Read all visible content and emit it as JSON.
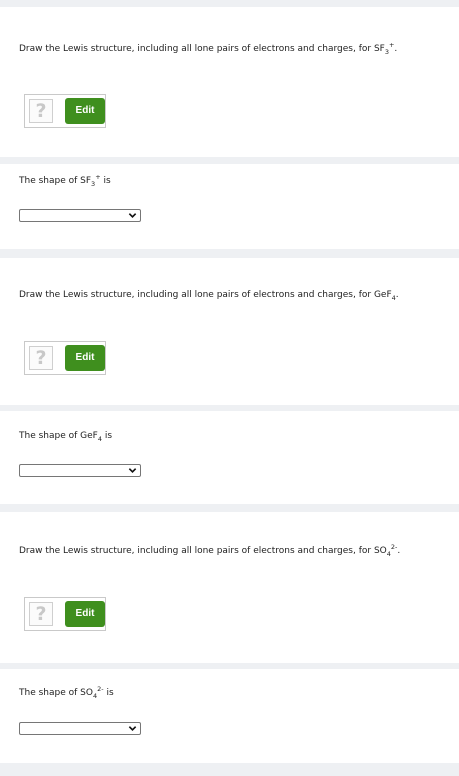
{
  "questions": [
    {
      "draw_prefix": "Draw the Lewis structure, including all lone pairs of electrons and charges, for ",
      "formula_base": "SF",
      "formula_sub": "3",
      "formula_sup": "+",
      "draw_suffix": ".",
      "edit_label": "Edit",
      "help_glyph": "?",
      "shape_prefix": "The shape of ",
      "shape_suffix": " is",
      "shape_selected": ""
    },
    {
      "draw_prefix": "Draw the Lewis structure, including all lone pairs of electrons and charges, for ",
      "formula_base": "GeF",
      "formula_sub": "4",
      "formula_sup": "",
      "draw_suffix": ".",
      "edit_label": "Edit",
      "help_glyph": "?",
      "shape_prefix": "The shape of ",
      "shape_suffix": " is",
      "shape_selected": ""
    },
    {
      "draw_prefix": "Draw the Lewis structure, including all lone pairs of electrons and charges, for ",
      "formula_base": "SO",
      "formula_sub": "4",
      "formula_sup": "2-",
      "draw_suffix": ".",
      "edit_label": "Edit",
      "help_glyph": "?",
      "shape_prefix": "The shape of ",
      "shape_suffix": " is",
      "shape_selected": ""
    }
  ],
  "colors": {
    "edit_button": "#3f8f1e",
    "page_background": "#eef0f3",
    "panel_background": "#ffffff"
  },
  "icons": {
    "help": "question-mark-icon",
    "dropdown": "chevron-down-icon"
  }
}
